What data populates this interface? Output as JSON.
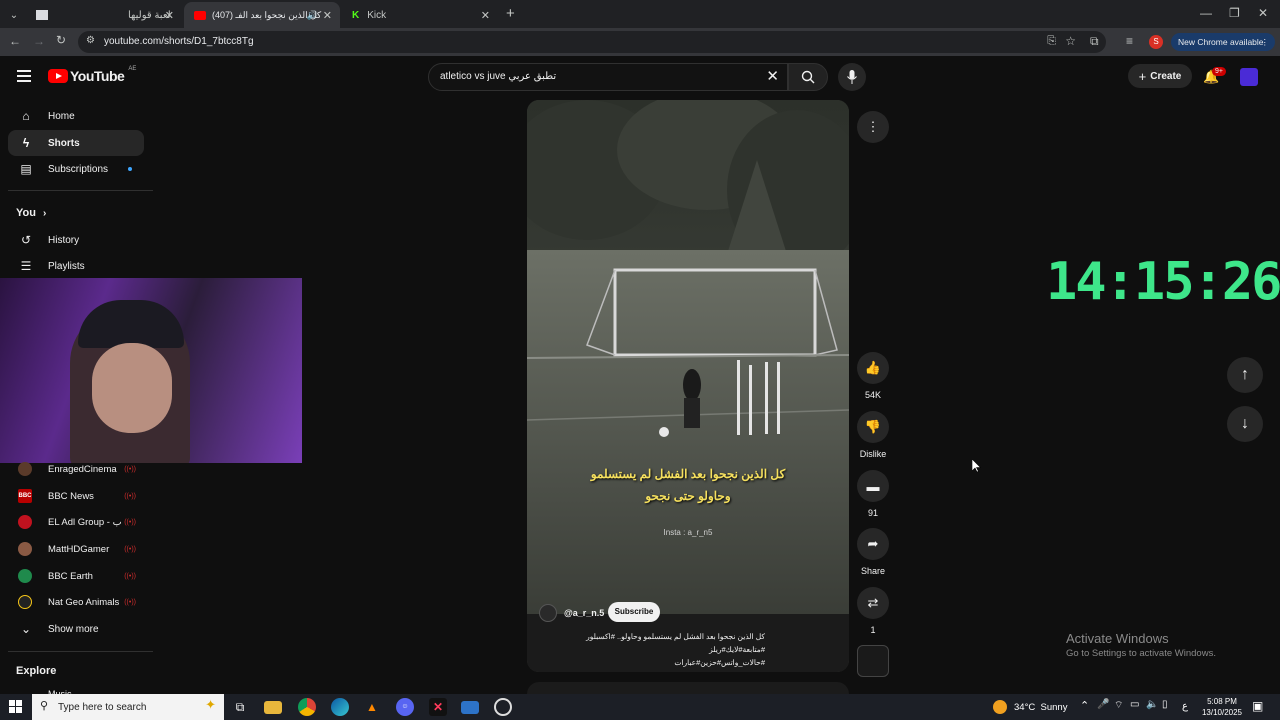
{
  "browser": {
    "tabs": [
      {
        "label": "لعبة قوليها",
        "active": false
      },
      {
        "label": "(407) كل الذين نجحوا بعد الفـ",
        "active": true
      },
      {
        "label": "Kick",
        "active": false
      }
    ],
    "url": "youtube.com/shorts/D1_7btcc8Tg",
    "new_chrome_label": "New Chrome available",
    "profile_initial": "S"
  },
  "youtube": {
    "logo_text": "YouTube",
    "region": "AE",
    "search_value": "atletico vs juve تطبق عربي",
    "create_label": "Create",
    "notification_count": "9+"
  },
  "sidebar": {
    "items": [
      {
        "label": "Home",
        "icon": "home-icon"
      },
      {
        "label": "Shorts",
        "icon": "shorts-icon"
      },
      {
        "label": "Subscriptions",
        "icon": "subscriptions-icon"
      }
    ],
    "you_label": "You",
    "you_items": [
      {
        "label": "History",
        "icon": "history-icon"
      },
      {
        "label": "Playlists",
        "icon": "playlists-icon"
      }
    ],
    "channels": [
      {
        "label": "EnragedCinema",
        "color": "#5b3b2a"
      },
      {
        "label": "BBC News",
        "color": "#b80000"
      },
      {
        "label": "EL Adl Group - ب",
        "color": "#c1121f"
      },
      {
        "label": "MattHDGamer",
        "color": "#8a5a44"
      },
      {
        "label": "BBC Earth",
        "color": "#1f8a4c"
      },
      {
        "label": "Nat Geo Animals",
        "color": "#222222"
      }
    ],
    "show_more_label": "Show more",
    "explore_label": "Explore",
    "music_label": "Music"
  },
  "short": {
    "caption_line1": "كل الذين نجحوا بعد الفشل لم يستسلمو",
    "caption_line2": "وحاولو حتى نجحو",
    "watermark": "Insta : a_r_n5",
    "channel_handle": "@a_r_n.5",
    "subscribe_label": "Subscribe",
    "description_line1": "كل الذين نجحوا بعد الفشل لم يستسلمو وحاولو.. #اكسبلور #متابعة#لايك#ريلز",
    "description_line2": "#حالات_واتس#حزين#عبارات",
    "likes": "54K",
    "dislike_label": "Dislike",
    "comments": "91",
    "share_label": "Share",
    "remix_count": "1"
  },
  "overlay": {
    "clock": "14:15:26",
    "activate_title": "Activate Windows",
    "activate_sub": "Go to Settings to activate Windows."
  },
  "taskbar": {
    "search_placeholder": "Type here to search",
    "weather": "34°C  Sunny",
    "time": "5:08 PM",
    "date": "13/10/2025",
    "lang": "ع"
  }
}
